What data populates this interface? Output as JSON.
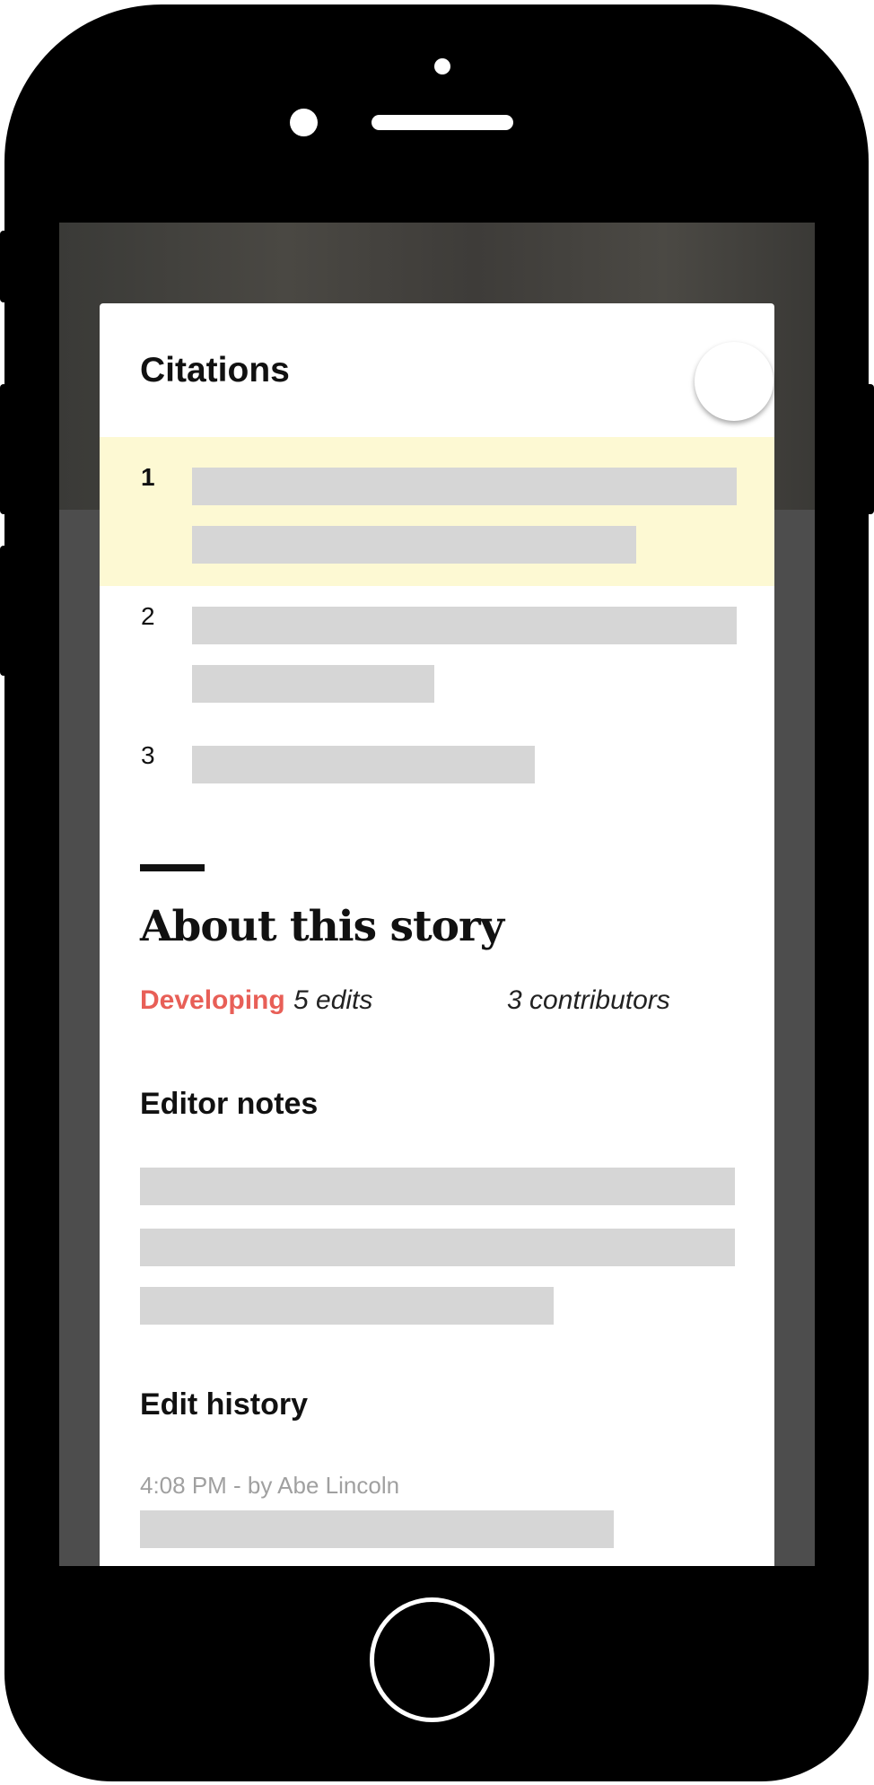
{
  "citations": {
    "title": "Citations",
    "items": [
      {
        "number": "1"
      },
      {
        "number": "2"
      },
      {
        "number": "3"
      }
    ]
  },
  "about": {
    "title": "About this story",
    "status": "Developing",
    "edits": "5 edits",
    "contributors": "3 contributors"
  },
  "editor_notes": {
    "title": "Editor notes"
  },
  "edit_history": {
    "title": "Edit history",
    "entries": [
      {
        "meta": "4:08 PM - by Abe Lincoln"
      }
    ]
  },
  "colors": {
    "status_accent": "#e85f57",
    "highlight": "#fdf9d3",
    "placeholder": "#d6d6d6"
  }
}
